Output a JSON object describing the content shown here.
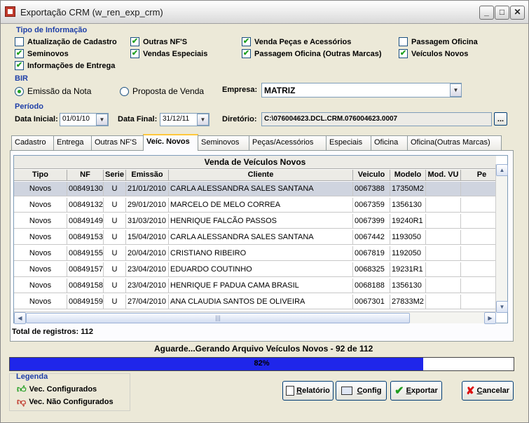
{
  "window": {
    "title": "Exportação CRM (w_ren_exp_crm)"
  },
  "tipo": {
    "label": "Tipo de Informação",
    "items": [
      {
        "label": "Atualização de Cadastro",
        "checked": false
      },
      {
        "label": "Outras NF'S",
        "checked": true
      },
      {
        "label": "Venda Peças e Acessórios",
        "checked": true
      },
      {
        "label": "Passagem Oficina",
        "checked": false
      },
      {
        "label": "Seminovos",
        "checked": true
      },
      {
        "label": "Vendas  Especiais",
        "checked": true
      },
      {
        "label": "Passagem Oficina (Outras Marcas)",
        "checked": true
      },
      {
        "label": "Veículos Novos",
        "checked": true
      },
      {
        "label": "Informações de Entrega",
        "checked": true
      }
    ]
  },
  "bir": {
    "label": "BIR",
    "option1": "Emissão da Nota",
    "option2": "Proposta de Venda",
    "selected": "Emissão da Nota"
  },
  "empresa": {
    "label": "Empresa:",
    "value": "MATRIZ"
  },
  "periodo": {
    "label": "Período",
    "inicial_label": "Data Inicial:",
    "inicial": "01/01/10",
    "final_label": "Data Final:",
    "final": "31/12/11"
  },
  "diretorio": {
    "label": "Diretório:",
    "value": "C:\\076004623.DCL.CRM.076004623.0007",
    "button": "..."
  },
  "tabs": [
    "Cadastro",
    "Entrega",
    "Outras NF'S",
    "Veíc. Novos",
    "Seminovos",
    "Peças/Acessórios",
    "Especiais",
    "Oficina",
    "Oficina(Outras Marcas)"
  ],
  "active_tab": "Veíc. Novos",
  "table": {
    "title": "Venda de Veículos Novos",
    "columns": [
      "Tipo",
      "NF",
      "Serie",
      "Emissão",
      "Cliente",
      "Veiculo",
      "Modelo",
      "Mod. VU",
      "Pe"
    ],
    "rows": [
      [
        "Novos",
        "00849130",
        "U",
        "21/01/2010",
        "CARLA ALESSANDRA SALES SANTANA",
        "0067388",
        "17350M2",
        "",
        ""
      ],
      [
        "Novos",
        "00849132",
        "U",
        "29/01/2010",
        "MARCELO DE MELO CORREA",
        "0067359",
        "1356130",
        "",
        ""
      ],
      [
        "Novos",
        "00849149",
        "U",
        "31/03/2010",
        "HENRIQUE FALCÃO PASSOS",
        "0067399",
        "19240R1",
        "",
        ""
      ],
      [
        "Novos",
        "00849153",
        "U",
        "15/04/2010",
        "CARLA ALESSANDRA SALES SANTANA",
        "0067442",
        "1193050",
        "",
        ""
      ],
      [
        "Novos",
        "00849155",
        "U",
        "20/04/2010",
        "CRISTIANO RIBEIRO",
        "0067819",
        "1192050",
        "",
        ""
      ],
      [
        "Novos",
        "00849157",
        "U",
        "23/04/2010",
        "EDUARDO COUTINHO",
        "0068325",
        "19231R1",
        "",
        ""
      ],
      [
        "Novos",
        "00849158",
        "U",
        "23/04/2010",
        "HENRIQUE F PADUA CAMA BRASIL",
        "0068188",
        "1356130",
        "",
        ""
      ],
      [
        "Novos",
        "00849159",
        "U",
        "27/04/2010",
        "ANA CLAUDIA SANTOS DE OLIVEIRA",
        "0067301",
        "27833M2",
        "",
        ""
      ]
    ],
    "selected_row": 0
  },
  "total": "Total de registros: 112",
  "status": "Aguarde...Gerando Arquivo Veículos Novos - 92 de 112",
  "progress": {
    "value": 0.82,
    "text": "82%"
  },
  "legend": {
    "label": "Legenda",
    "configured": "Vec. Configurados",
    "not_configured": "Vec. Não Configurados",
    "configured_color": "#1f9d1f",
    "not_configured_color": "#c0392b"
  },
  "buttons": {
    "relatorio_u": "R",
    "relatorio": "elatório",
    "config_u": "C",
    "config": "onfig",
    "exportar_u": "E",
    "exportar": "xportar",
    "cancelar_u": "C",
    "cancelar": "ancelar"
  }
}
